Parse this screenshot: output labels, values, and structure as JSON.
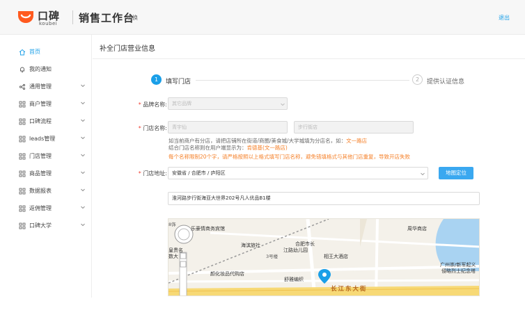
{
  "header": {
    "logo_cn": "口碑",
    "logo_en": "koubei",
    "app_title": "销售工作台",
    "switch_label": "切换",
    "logout_label": "退出"
  },
  "sidebar": {
    "items": [
      {
        "label": "首页",
        "icon": "home-icon",
        "active": true,
        "expandable": false
      },
      {
        "label": "我的通知",
        "icon": "bell-icon",
        "active": false,
        "expandable": false
      },
      {
        "label": "通用管理",
        "icon": "share-icon",
        "active": false,
        "expandable": true
      },
      {
        "label": "商户管理",
        "icon": "grid-icon",
        "active": false,
        "expandable": true
      },
      {
        "label": "口碑流程",
        "icon": "grid-icon",
        "active": false,
        "expandable": true
      },
      {
        "label": "leads管理",
        "icon": "grid-icon",
        "active": false,
        "expandable": true
      },
      {
        "label": "门店管理",
        "icon": "grid-icon",
        "active": false,
        "expandable": true
      },
      {
        "label": "商品管理",
        "icon": "grid-icon",
        "active": false,
        "expandable": true
      },
      {
        "label": "数据报表",
        "icon": "grid-icon",
        "active": false,
        "expandable": true
      },
      {
        "label": "返佣管理",
        "icon": "grid-icon",
        "active": false,
        "expandable": true
      },
      {
        "label": "口碑大学",
        "icon": "grid-icon",
        "active": false,
        "expandable": true
      }
    ]
  },
  "main": {
    "title": "补全门店营业信息",
    "steps": [
      {
        "number": "1",
        "label": "填写门店",
        "active": true
      },
      {
        "number": "2",
        "label": "提供认证信息",
        "active": false
      }
    ],
    "form": {
      "brand": {
        "label": "品牌名称:",
        "placeholder": "其它品牌"
      },
      "store_name": {
        "label": "门店名称:",
        "main_placeholder": "青宇仙",
        "branch_placeholder": "步行街店",
        "help_1": "如当前商户有分店，请把店铺所在街道/商圈/美食城/大学城填为分店名，如：",
        "help_1_example": "文一路店",
        "help_2": "结合门店名称则在用户端显示为：",
        "help_2_example": "肯德基(文一路店)",
        "warning": "每个名称限制20个字，请严格按照以上格式填写门店名称，避免错填格式与其他门店重复，导致开店失败"
      },
      "address": {
        "label": "门店地址:",
        "region_value": "安徽省 / 合肥市 / 庐阳区",
        "locate_button": "地图定位",
        "detail_value": "淮河路步行街海亚大世界202号凡人优品B1楼"
      }
    },
    "map": {
      "labels": [
        "乐豪情商务宾馆",
        "海滨旅社",
        "合肥市长",
        "江路幼儿园",
        "3号楼",
        "相王大酒店",
        "周华商店",
        "广州崇/新军起义",
        "侵略烈士纪念塔",
        "颜化妆品代购店",
        "舒雅编织",
        "长江东大街"
      ],
      "clipped_labels": [
        "8饰",
        "皇贵名",
        "数大"
      ]
    }
  }
}
